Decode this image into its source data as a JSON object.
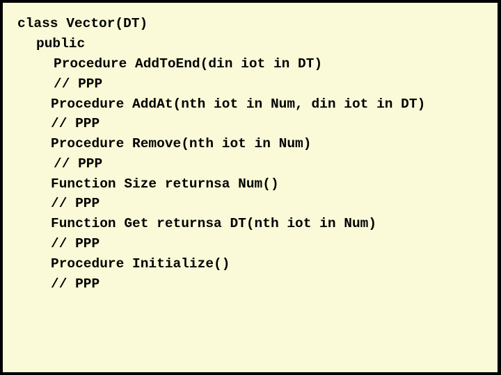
{
  "slide": {
    "background_color": "#FAFAD8",
    "border_color": "#000000",
    "code_lines": [
      {
        "text": "class Vector(DT)",
        "indent": 0
      },
      {
        "text": "public",
        "indent": 1
      },
      {
        "text": "Procedure AddToEnd(din iot in DT)",
        "indent": 2
      },
      {
        "text": "// PPP",
        "indent": 2
      },
      {
        "text": "Procedure AddAt(nth iot in Num, din iot in DT)",
        "indent": 2
      },
      {
        "text": "// PPP",
        "indent": 2
      },
      {
        "text": "Procedure Remove(nth iot in Num)",
        "indent": 2
      },
      {
        "text": "// PPP",
        "indent": 2
      },
      {
        "text": "Function Size returnsa Num()",
        "indent": 2
      },
      {
        "text": "// PPP",
        "indent": 2
      },
      {
        "text": "Function Get returnsa DT(nth iot in Num)",
        "indent": 2
      },
      {
        "text": "// PPP",
        "indent": 2
      },
      {
        "text": "Procedure Initialize()",
        "indent": 2
      },
      {
        "text": "// PPP",
        "indent": 2
      }
    ]
  }
}
